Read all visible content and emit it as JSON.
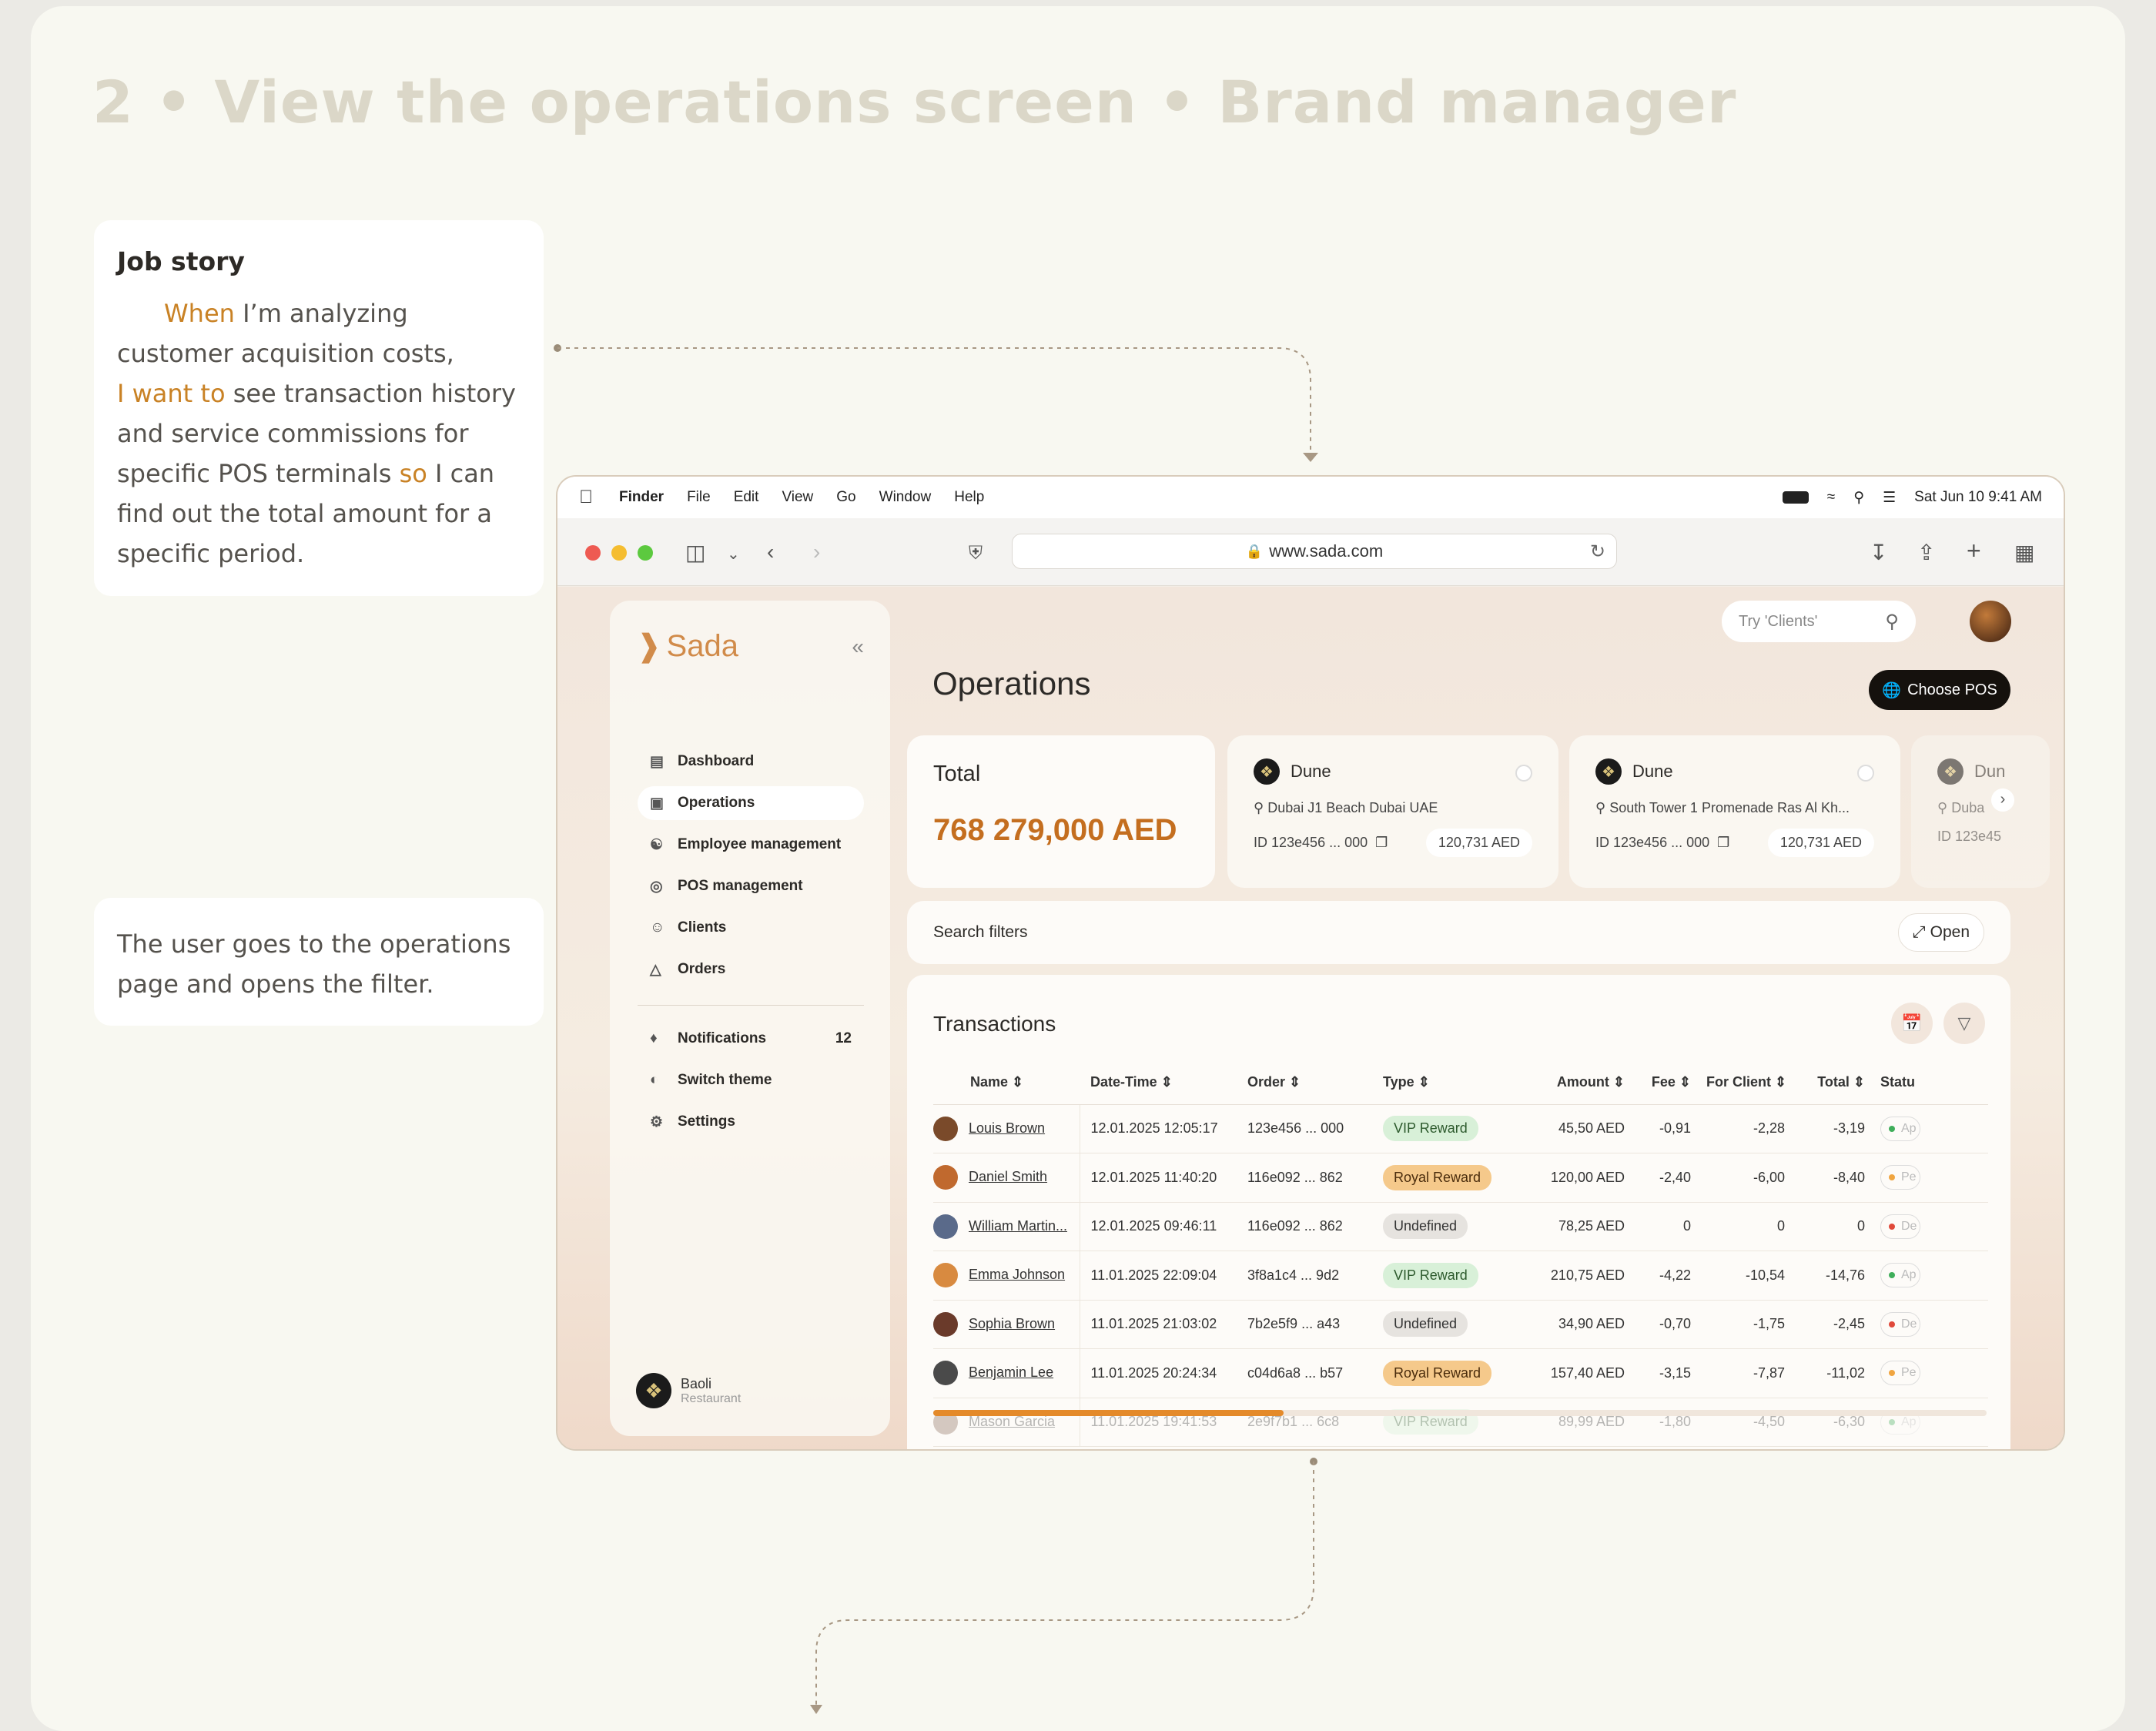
{
  "page": {
    "title": "2 • View the operations screen • Brand manager",
    "job_story": {
      "heading": "Job story",
      "when": "When",
      "t1": " I’m analyzing customer acquisition costs,",
      "want": "I want to",
      "t2": " see transaction history and service commissions for specific POS terminals ",
      "so": "so",
      "t3": " I can find out the total amount for a specific period."
    },
    "note": "The user goes to the operations page and opens the filter."
  },
  "os_menu": {
    "app": "Finder",
    "items": [
      "File",
      "Edit",
      "View",
      "Go",
      "Window",
      "Help"
    ],
    "datetime": "Sat Jun 10  9:41 AM"
  },
  "browser": {
    "url": "www.sada.com"
  },
  "sidebar": {
    "logo": "Sada",
    "nav": [
      {
        "label": "Dashboard",
        "icon": "chart-icon"
      },
      {
        "label": "Operations",
        "icon": "card-icon",
        "active": true
      },
      {
        "label": "Employee management",
        "icon": "users-icon"
      },
      {
        "label": "POS management",
        "icon": "pin-icon"
      },
      {
        "label": "Clients",
        "icon": "client-icon"
      },
      {
        "label": "Orders",
        "icon": "bag-icon"
      }
    ],
    "secondary": [
      {
        "label": "Notifications",
        "icon": "bell-icon",
        "count": "12"
      },
      {
        "label": "Switch theme",
        "icon": "theme-icon"
      },
      {
        "label": "Settings",
        "icon": "gear-icon"
      }
    ],
    "brand": {
      "name": "Baoli",
      "type": "Restaurant"
    }
  },
  "header": {
    "search_placeholder": "Try 'Clients'",
    "page_title": "Operations",
    "choose_pos": "Choose POS"
  },
  "total": {
    "label": "Total",
    "value": "768 279,000 AED"
  },
  "pos_cards": [
    {
      "name": "Dune",
      "address": "Dubai J1 Beach Dubai UAE",
      "id": "ID 123e456 ... 000",
      "amount": "120,731 AED"
    },
    {
      "name": "Dune",
      "address": "South Tower 1 Promenade Ras Al Kh...",
      "id": "ID 123e456 ... 000",
      "amount": "120,731 AED"
    },
    {
      "name": "Dun",
      "address": "Duba",
      "id": "ID 123e45",
      "amount": ""
    }
  ],
  "filters": {
    "label": "Search filters",
    "open": "Open"
  },
  "transactions": {
    "title": "Transactions",
    "columns": [
      "Name",
      "Date-Time",
      "Order",
      "Type",
      "Amount",
      "Fee",
      "For Client",
      "Total",
      "Statu"
    ],
    "rows": [
      {
        "name": "Louis Brown",
        "dt": "12.01.2025 12:05:17",
        "order": "123e456 ... 000",
        "type": "VIP Reward",
        "kind": "vip",
        "amount": "45,50 AED",
        "fee": "-0,91",
        "client": "-2,28",
        "total": "-3,19",
        "status": "Ap",
        "sc": "#3fae5a",
        "avc": "#7a4a2a"
      },
      {
        "name": "Daniel Smith",
        "dt": "12.01.2025 11:40:20",
        "order": "116e092 ... 862",
        "type": "Royal Reward",
        "kind": "royal",
        "amount": "120,00 AED",
        "fee": "-2,40",
        "client": "-6,00",
        "total": "-8,40",
        "status": "Pe",
        "sc": "#f0a540",
        "avc": "#c0692e"
      },
      {
        "name": "William Martin...",
        "dt": "12.01.2025 09:46:11",
        "order": "116e092 ... 862",
        "type": "Undefined",
        "kind": "und",
        "amount": "78,25 AED",
        "fee": "0",
        "client": "0",
        "total": "0",
        "status": "De",
        "sc": "#e0493a",
        "avc": "#5a6a8a"
      },
      {
        "name": "Emma Johnson",
        "dt": "11.01.2025 22:09:04",
        "order": "3f8a1c4 ... 9d2",
        "type": "VIP Reward",
        "kind": "vip",
        "amount": "210,75 AED",
        "fee": "-4,22",
        "client": "-10,54",
        "total": "-14,76",
        "status": "Ap",
        "sc": "#3fae5a",
        "avc": "#d88a40"
      },
      {
        "name": "Sophia Brown",
        "dt": "11.01.2025 21:03:02",
        "order": "7b2e5f9 ... a43",
        "type": "Undefined",
        "kind": "und",
        "amount": "34,90 AED",
        "fee": "-0,70",
        "client": "-1,75",
        "total": "-2,45",
        "status": "De",
        "sc": "#e0493a",
        "avc": "#6a3a2a"
      },
      {
        "name": "Benjamin Lee",
        "dt": "11.01.2025 20:24:34",
        "order": "c04d6a8 ... b57",
        "type": "Royal Reward",
        "kind": "royal",
        "amount": "157,40 AED",
        "fee": "-3,15",
        "client": "-7,87",
        "total": "-11,02",
        "status": "Pe",
        "sc": "#f0a540",
        "avc": "#4a4a4a"
      },
      {
        "name": "Mason Garcia",
        "dt": "11.01.2025 19:41:53",
        "order": "2e9f7b1 ... 6c8",
        "type": "VIP Reward",
        "kind": "vip",
        "amount": "89,99 AED",
        "fee": "-1,80",
        "client": "-4,50",
        "total": "-6,30",
        "status": "Ap",
        "sc": "#3fae5a",
        "avc": "#8a6a5a"
      }
    ]
  }
}
